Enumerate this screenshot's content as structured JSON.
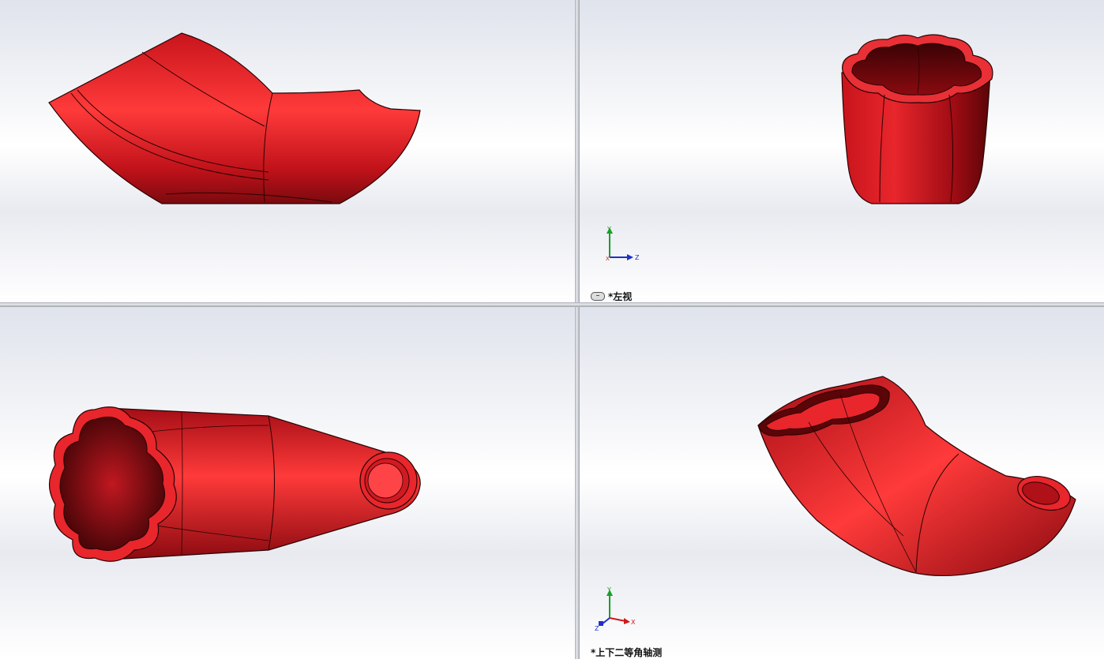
{
  "viewports": {
    "top_left": {
      "label": ""
    },
    "top_right": {
      "label": "*左视",
      "triad": {
        "x": "X",
        "y": "Y",
        "z": "Z"
      }
    },
    "bottom_left": {
      "label": ""
    },
    "bottom_right": {
      "label": "*上下二等角轴测",
      "triad": {
        "x": "X",
        "y": "Y",
        "z": "Z"
      }
    }
  },
  "colors": {
    "part": "#e0202a",
    "part_dark": "#7a0a0e",
    "edge": "#2a0304",
    "triad_x": "#d01818",
    "triad_y": "#18a028",
    "triad_z": "#2030c8"
  },
  "icons": {
    "view_link": "link-icon"
  }
}
